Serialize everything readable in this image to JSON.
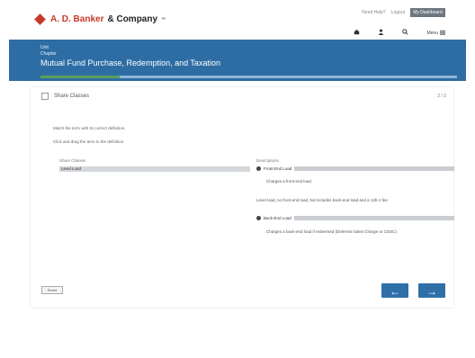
{
  "header": {
    "logo_a": "A. D. Banker",
    "logo_b": "& Company",
    "logo_tm": "™",
    "top_link_1": "Need Help?",
    "top_link_2": "Logout",
    "signin_label": "My Dashboard",
    "icons": [
      "home-icon",
      "user-icon",
      "search-icon",
      "menu-icon"
    ],
    "menu_label": "Menu"
  },
  "banner": {
    "line1": "Unit",
    "line2": "Chapter",
    "title": "Mutual Fund Purchase, Redemption, and Taxation",
    "progress_fraction": 0.19
  },
  "card": {
    "title": "Share Classes",
    "counter": "2 / 2",
    "instruction_1": "Match the term with its correct definition.",
    "instruction_2": "Click and drag the term to the definition.",
    "share_head": "Share Classes",
    "desc_head": "Descriptions",
    "drag_item": "Level Load",
    "drop_1_label": "Front-End Load",
    "desc_1": "Charges a front-end load.",
    "desc_2": "Level load; no front-end load, but includes back-end load and a 12b-1 fee",
    "drop_2_label": "Back-End Load",
    "desc_3": "Charges a back-end load if redeemed (Deferred Sales Charge or CDSC)"
  },
  "footer": {
    "small_btn": "Reset",
    "prev_label": "←",
    "next_label": "→"
  },
  "colors": {
    "banner": "#2e6da4",
    "brand_red": "#c8392b",
    "button_blue": "#2f6fa8"
  }
}
